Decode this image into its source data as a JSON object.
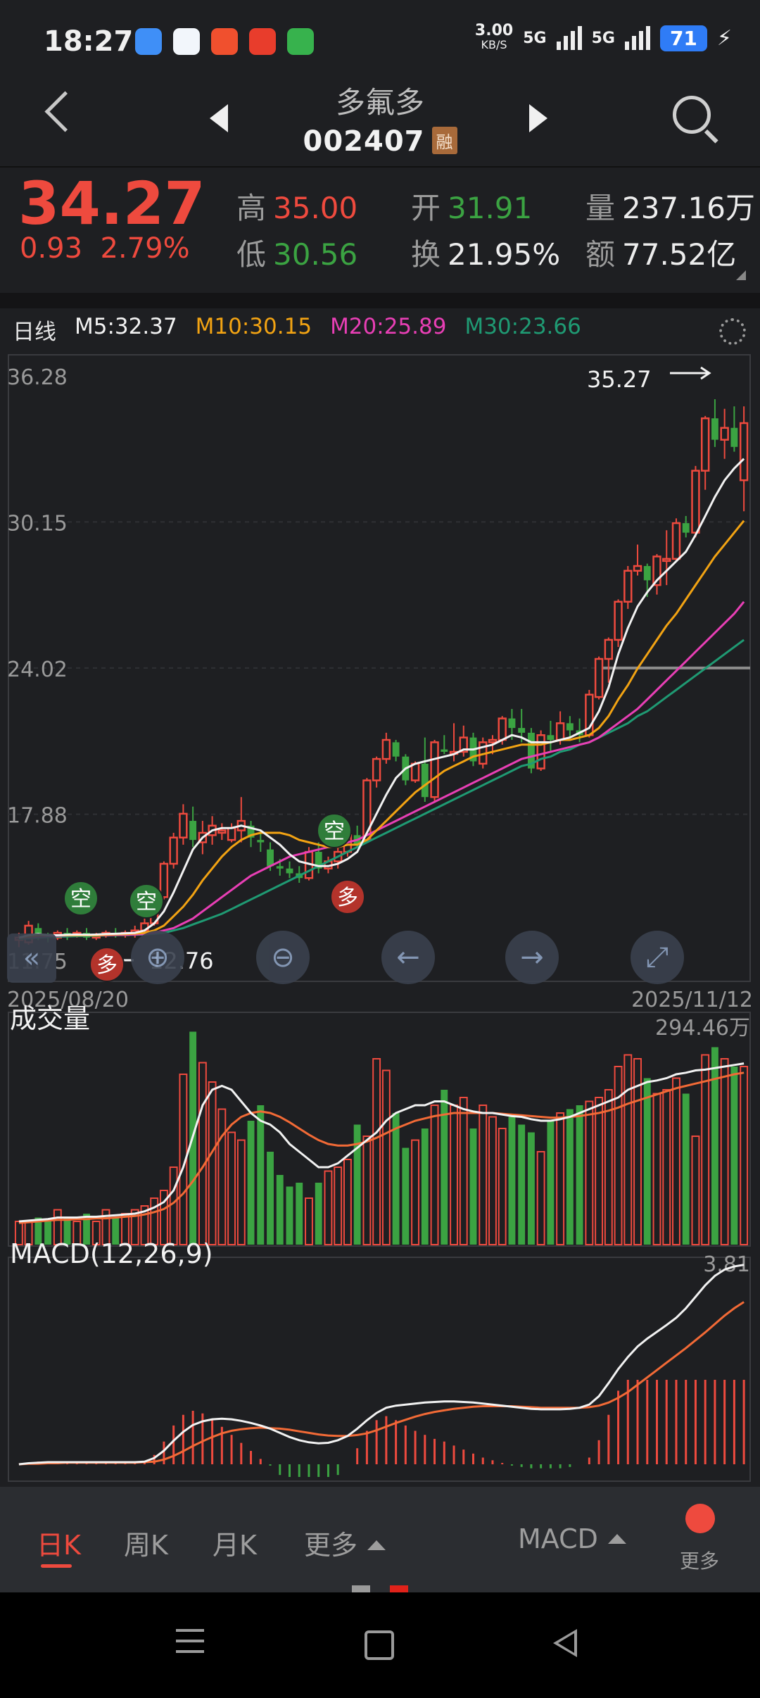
{
  "status": {
    "time": "18:27",
    "speed_value": "3.00",
    "speed_unit": "KB/S",
    "signal1": "5G",
    "signal2": "5G",
    "battery": "71"
  },
  "header": {
    "stock_name": "多氟多",
    "stock_code": "002407",
    "badge": "融"
  },
  "quote": {
    "price": "34.27",
    "change": "0.93",
    "change_pct": "2.79%",
    "high_label": "高",
    "high": "35.00",
    "low_label": "低",
    "low": "30.56",
    "open_label": "开",
    "open": "31.91",
    "turnover_label": "换",
    "turnover": "21.95%",
    "volume_label": "量",
    "volume": "237.16万",
    "amount_label": "额",
    "amount": "77.52亿"
  },
  "ma": {
    "period": "日线",
    "m5": "M5:32.37",
    "m10": "M10:30.15",
    "m20": "M20:25.89",
    "m30": "M30:23.66"
  },
  "colors": {
    "up": "#ee4a3e",
    "down": "#3ba342",
    "m5": "#f2f2f2",
    "m10": "#f2a313",
    "m20": "#e83fb5",
    "m30": "#1f9a73"
  },
  "chart_data": [
    {
      "type": "candlestick",
      "title": "日线",
      "y_ticks": [
        "36.28",
        "30.15",
        "24.02",
        "17.88",
        "11.75"
      ],
      "ylim": [
        11.75,
        36.28
      ],
      "x_start": "2025/08/20",
      "x_end": "2025/11/12",
      "max_label": "35.27",
      "min_label": "12.76",
      "reference_line": 24.02,
      "candles": [
        [
          12.6,
          12.9,
          12.3,
          12.7
        ],
        [
          12.5,
          13.4,
          12.4,
          13.2
        ],
        [
          13.1,
          13.3,
          12.6,
          12.8
        ],
        [
          12.8,
          12.9,
          12.5,
          12.7
        ],
        [
          12.7,
          13.0,
          12.6,
          12.9
        ],
        [
          12.9,
          13.1,
          12.6,
          12.8
        ],
        [
          12.8,
          13.0,
          12.7,
          12.9
        ],
        [
          12.9,
          13.1,
          12.6,
          12.7
        ],
        [
          12.7,
          12.9,
          12.6,
          12.8
        ],
        [
          12.8,
          13.0,
          12.7,
          12.9
        ],
        [
          12.9,
          13.1,
          12.7,
          12.8
        ],
        [
          12.8,
          13.0,
          12.7,
          12.9
        ],
        [
          12.9,
          13.2,
          12.7,
          13.0
        ],
        [
          13.0,
          13.5,
          12.8,
          13.3
        ],
        [
          13.3,
          14.5,
          13.2,
          14.4
        ],
        [
          14.4,
          15.9,
          14.3,
          15.8
        ],
        [
          15.8,
          17.1,
          15.6,
          16.9
        ],
        [
          16.9,
          18.3,
          16.6,
          17.9
        ],
        [
          17.6,
          18.2,
          16.5,
          16.8
        ],
        [
          16.7,
          17.6,
          16.2,
          17.1
        ],
        [
          17.0,
          17.8,
          16.6,
          17.4
        ],
        [
          17.1,
          17.5,
          16.8,
          17.2
        ],
        [
          16.8,
          17.5,
          16.7,
          17.3
        ],
        [
          17.2,
          18.6,
          16.7,
          17.6
        ],
        [
          17.4,
          17.6,
          16.5,
          16.9
        ],
        [
          16.8,
          17.2,
          16.3,
          16.7
        ],
        [
          16.4,
          16.7,
          15.5,
          15.7
        ],
        [
          15.7,
          16.0,
          15.3,
          15.6
        ],
        [
          15.6,
          15.9,
          15.2,
          15.4
        ],
        [
          15.4,
          15.7,
          15.0,
          15.2
        ],
        [
          15.2,
          16.5,
          15.1,
          16.3
        ],
        [
          16.3,
          16.7,
          15.4,
          15.6
        ],
        [
          15.6,
          16.1,
          15.4,
          15.9
        ],
        [
          15.9,
          16.5,
          15.6,
          16.3
        ],
        [
          16.3,
          17.2,
          16.1,
          17.0
        ],
        [
          17.0,
          17.4,
          16.5,
          16.6
        ],
        [
          16.8,
          19.4,
          16.7,
          19.3
        ],
        [
          19.3,
          20.3,
          19.0,
          20.2
        ],
        [
          20.2,
          21.3,
          20.0,
          21.0
        ],
        [
          20.9,
          21.0,
          20.1,
          20.3
        ],
        [
          20.3,
          20.4,
          19.1,
          19.3
        ],
        [
          19.3,
          20.1,
          19.2,
          20.0
        ],
        [
          20.0,
          21.1,
          18.4,
          18.6
        ],
        [
          18.6,
          21.0,
          18.4,
          20.9
        ],
        [
          20.6,
          21.2,
          20.4,
          20.5
        ],
        [
          20.5,
          21.7,
          20.1,
          20.5
        ],
        [
          20.5,
          21.6,
          20.3,
          21.1
        ],
        [
          21.1,
          21.3,
          19.9,
          20.1
        ],
        [
          20.0,
          21.1,
          19.8,
          20.9
        ],
        [
          20.9,
          21.2,
          20.4,
          21.0
        ],
        [
          21.0,
          22.0,
          20.8,
          21.9
        ],
        [
          21.9,
          22.3,
          21.0,
          21.5
        ],
        [
          21.5,
          22.3,
          20.9,
          21.3
        ],
        [
          21.3,
          21.5,
          19.6,
          19.8
        ],
        [
          19.8,
          21.4,
          19.7,
          21.2
        ],
        [
          21.2,
          21.8,
          20.5,
          21.0
        ],
        [
          21.0,
          22.2,
          20.8,
          21.7
        ],
        [
          21.7,
          22.0,
          21.1,
          21.4
        ],
        [
          21.4,
          21.9,
          20.9,
          21.2
        ],
        [
          21.2,
          23.1,
          21.1,
          22.9
        ],
        [
          22.8,
          24.5,
          22.7,
          24.4
        ],
        [
          24.4,
          25.3,
          23.4,
          25.2
        ],
        [
          25.2,
          26.9,
          24.9,
          26.8
        ],
        [
          26.8,
          28.3,
          26.5,
          28.1
        ],
        [
          28.1,
          29.2,
          27.9,
          28.3
        ],
        [
          28.3,
          28.4,
          27.0,
          27.7
        ],
        [
          27.5,
          28.8,
          27.1,
          28.7
        ],
        [
          28.6,
          29.8,
          27.5,
          28.6
        ],
        [
          28.6,
          30.3,
          28.5,
          30.1
        ],
        [
          30.1,
          30.4,
          29.5,
          29.7
        ],
        [
          29.7,
          32.5,
          29.5,
          32.3
        ],
        [
          32.3,
          34.6,
          31.5,
          34.5
        ],
        [
          34.5,
          35.3,
          33.3,
          33.6
        ],
        [
          33.6,
          34.9,
          32.8,
          34.1
        ],
        [
          34.1,
          35.0,
          33.1,
          33.3
        ],
        [
          31.9,
          35.0,
          30.6,
          34.3
        ]
      ],
      "m5": [
        12.7,
        12.8,
        12.85,
        12.8,
        12.8,
        12.82,
        12.83,
        12.82,
        12.83,
        12.85,
        12.86,
        12.88,
        12.9,
        13.0,
        13.3,
        13.8,
        14.6,
        15.5,
        16.4,
        16.9,
        17.2,
        17.3,
        17.3,
        17.4,
        17.3,
        17.2,
        16.9,
        16.6,
        16.2,
        15.9,
        15.8,
        15.7,
        15.7,
        15.8,
        16.0,
        16.3,
        17.1,
        17.9,
        18.7,
        19.4,
        19.8,
        20.0,
        20.1,
        20.2,
        20.3,
        20.4,
        20.6,
        20.6,
        20.7,
        20.8,
        21.0,
        21.2,
        21.1,
        20.9,
        20.9,
        20.9,
        21.0,
        21.1,
        21.3,
        21.5,
        22.2,
        23.2,
        24.6,
        25.7,
        26.6,
        27.2,
        27.7,
        28.1,
        28.5,
        28.9,
        29.6,
        30.4,
        31.2,
        31.9,
        32.4,
        32.8
      ],
      "m10": [
        12.7,
        12.75,
        12.8,
        12.8,
        12.8,
        12.8,
        12.8,
        12.8,
        12.8,
        12.82,
        12.84,
        12.85,
        12.87,
        12.9,
        13.0,
        13.2,
        13.6,
        14.0,
        14.5,
        15.1,
        15.6,
        16.1,
        16.5,
        16.8,
        17.0,
        17.1,
        17.1,
        17.1,
        17.0,
        16.8,
        16.7,
        16.6,
        16.5,
        16.5,
        16.6,
        16.6,
        16.8,
        17.2,
        17.6,
        18.0,
        18.4,
        18.8,
        19.1,
        19.4,
        19.7,
        19.9,
        20.1,
        20.3,
        20.4,
        20.5,
        20.6,
        20.7,
        20.8,
        20.8,
        20.8,
        20.9,
        21.0,
        21.0,
        21.1,
        21.2,
        21.5,
        22.0,
        22.7,
        23.3,
        24.0,
        24.6,
        25.2,
        25.8,
        26.3,
        26.9,
        27.5,
        28.1,
        28.7,
        29.2,
        29.7,
        30.2
      ],
      "m20": [
        12.7,
        12.72,
        12.75,
        12.77,
        12.78,
        12.79,
        12.8,
        12.8,
        12.8,
        12.8,
        12.81,
        12.82,
        12.83,
        12.85,
        12.9,
        13.0,
        13.1,
        13.3,
        13.5,
        13.8,
        14.1,
        14.4,
        14.7,
        15.0,
        15.3,
        15.5,
        15.7,
        15.9,
        16.1,
        16.2,
        16.3,
        16.4,
        16.5,
        16.6,
        16.7,
        16.8,
        17.0,
        17.2,
        17.4,
        17.6,
        17.8,
        18.0,
        18.2,
        18.4,
        18.6,
        18.8,
        19.0,
        19.2,
        19.4,
        19.6,
        19.8,
        20.0,
        20.2,
        20.3,
        20.4,
        20.5,
        20.6,
        20.7,
        20.8,
        20.9,
        21.1,
        21.4,
        21.7,
        22.0,
        22.3,
        22.7,
        23.1,
        23.5,
        23.9,
        24.3,
        24.7,
        25.1,
        25.5,
        25.9,
        26.3,
        26.8
      ],
      "m30": [
        12.65,
        12.67,
        12.7,
        12.72,
        12.74,
        12.75,
        12.76,
        12.77,
        12.78,
        12.79,
        12.8,
        12.81,
        12.82,
        12.83,
        12.86,
        12.9,
        13.0,
        13.1,
        13.25,
        13.4,
        13.55,
        13.7,
        13.9,
        14.1,
        14.3,
        14.5,
        14.7,
        14.9,
        15.1,
        15.3,
        15.5,
        15.7,
        15.9,
        16.1,
        16.3,
        16.5,
        16.7,
        16.9,
        17.1,
        17.3,
        17.5,
        17.7,
        17.9,
        18.1,
        18.3,
        18.5,
        18.7,
        18.9,
        19.1,
        19.3,
        19.5,
        19.7,
        19.9,
        20.0,
        20.2,
        20.3,
        20.5,
        20.6,
        20.8,
        20.9,
        21.1,
        21.3,
        21.5,
        21.7,
        22.0,
        22.2,
        22.5,
        22.8,
        23.1,
        23.4,
        23.7,
        24.0,
        24.3,
        24.6,
        24.9,
        25.2
      ]
    },
    {
      "type": "bar",
      "title": "成交量",
      "max_label": "294.46万",
      "ylim": [
        0,
        300
      ],
      "values": [
        30,
        30,
        35,
        30,
        45,
        35,
        30,
        40,
        30,
        45,
        35,
        40,
        45,
        50,
        60,
        70,
        100,
        220,
        275,
        235,
        210,
        175,
        145,
        135,
        160,
        180,
        120,
        90,
        75,
        80,
        60,
        80,
        95,
        100,
        110,
        155,
        140,
        240,
        225,
        170,
        125,
        135,
        150,
        180,
        200,
        180,
        190,
        150,
        180,
        165,
        150,
        165,
        155,
        145,
        120,
        160,
        170,
        175,
        180,
        185,
        190,
        200,
        230,
        245,
        240,
        215,
        195,
        200,
        215,
        195,
        140,
        245,
        255,
        240,
        230,
        230
      ],
      "ma_a": [
        30,
        31,
        32,
        33,
        35,
        35,
        35,
        36,
        36,
        37,
        38,
        39,
        40,
        43,
        48,
        55,
        70,
        100,
        140,
        180,
        200,
        205,
        200,
        185,
        170,
        160,
        155,
        145,
        130,
        120,
        110,
        100,
        100,
        105,
        115,
        125,
        135,
        145,
        160,
        170,
        175,
        180,
        180,
        185,
        185,
        180,
        175,
        172,
        170,
        170,
        168,
        166,
        165,
        162,
        160,
        160,
        162,
        165,
        170,
        175,
        180,
        185,
        190,
        200,
        205,
        210,
        212,
        215,
        220,
        222,
        225,
        226,
        228,
        230,
        232,
        234
      ],
      "ma_b": [
        28,
        29,
        30,
        31,
        32,
        32,
        33,
        33,
        34,
        34,
        35,
        36,
        37,
        39,
        42,
        46,
        54,
        66,
        82,
        100,
        120,
        140,
        155,
        165,
        170,
        172,
        170,
        165,
        158,
        150,
        142,
        135,
        130,
        128,
        128,
        130,
        133,
        138,
        144,
        150,
        155,
        160,
        163,
        166,
        168,
        170,
        170,
        170,
        170,
        170,
        169,
        168,
        167,
        166,
        165,
        164,
        164,
        165,
        166,
        168,
        170,
        173,
        177,
        182,
        186,
        190,
        194,
        198,
        202,
        205,
        208,
        211,
        214,
        217,
        220,
        222
      ]
    },
    {
      "type": "line",
      "title": "MACD(12,26,9)",
      "max_label": "3.81",
      "dif": [
        0.0,
        0.02,
        0.03,
        0.04,
        0.04,
        0.04,
        0.04,
        0.04,
        0.04,
        0.04,
        0.04,
        0.04,
        0.04,
        0.05,
        0.12,
        0.26,
        0.45,
        0.62,
        0.75,
        0.82,
        0.86,
        0.87,
        0.86,
        0.83,
        0.79,
        0.74,
        0.68,
        0.6,
        0.52,
        0.46,
        0.42,
        0.4,
        0.41,
        0.46,
        0.54,
        0.68,
        0.84,
        0.98,
        1.08,
        1.12,
        1.14,
        1.16,
        1.18,
        1.19,
        1.2,
        1.2,
        1.19,
        1.18,
        1.16,
        1.14,
        1.12,
        1.1,
        1.08,
        1.06,
        1.05,
        1.05,
        1.05,
        1.06,
        1.08,
        1.14,
        1.3,
        1.55,
        1.82,
        2.05,
        2.25,
        2.4,
        2.53,
        2.66,
        2.8,
        2.98,
        3.2,
        3.42,
        3.6,
        3.72,
        3.78,
        3.81
      ],
      "dea": [
        0.0,
        0.01,
        0.01,
        0.02,
        0.02,
        0.03,
        0.03,
        0.03,
        0.03,
        0.03,
        0.03,
        0.03,
        0.03,
        0.04,
        0.05,
        0.09,
        0.16,
        0.25,
        0.35,
        0.44,
        0.52,
        0.59,
        0.64,
        0.67,
        0.69,
        0.7,
        0.69,
        0.68,
        0.66,
        0.63,
        0.6,
        0.57,
        0.55,
        0.54,
        0.54,
        0.56,
        0.59,
        0.65,
        0.72,
        0.79,
        0.85,
        0.91,
        0.96,
        1.0,
        1.03,
        1.06,
        1.08,
        1.1,
        1.11,
        1.11,
        1.11,
        1.11,
        1.1,
        1.09,
        1.08,
        1.08,
        1.08,
        1.08,
        1.08,
        1.09,
        1.12,
        1.18,
        1.27,
        1.38,
        1.52,
        1.66,
        1.8,
        1.94,
        2.08,
        2.22,
        2.37,
        2.52,
        2.68,
        2.84,
        2.98,
        3.1
      ]
    }
  ],
  "signals": [
    {
      "label": "空",
      "kind": "sell"
    },
    {
      "label": "空",
      "kind": "sell"
    },
    {
      "label": "空",
      "kind": "sell"
    },
    {
      "label": "多",
      "kind": "buy"
    },
    {
      "label": "多",
      "kind": "buy"
    }
  ],
  "tabs": {
    "day": "日K",
    "week": "周K",
    "month": "月K",
    "more": "更多",
    "indicator": "MACD",
    "more2": "更多"
  }
}
